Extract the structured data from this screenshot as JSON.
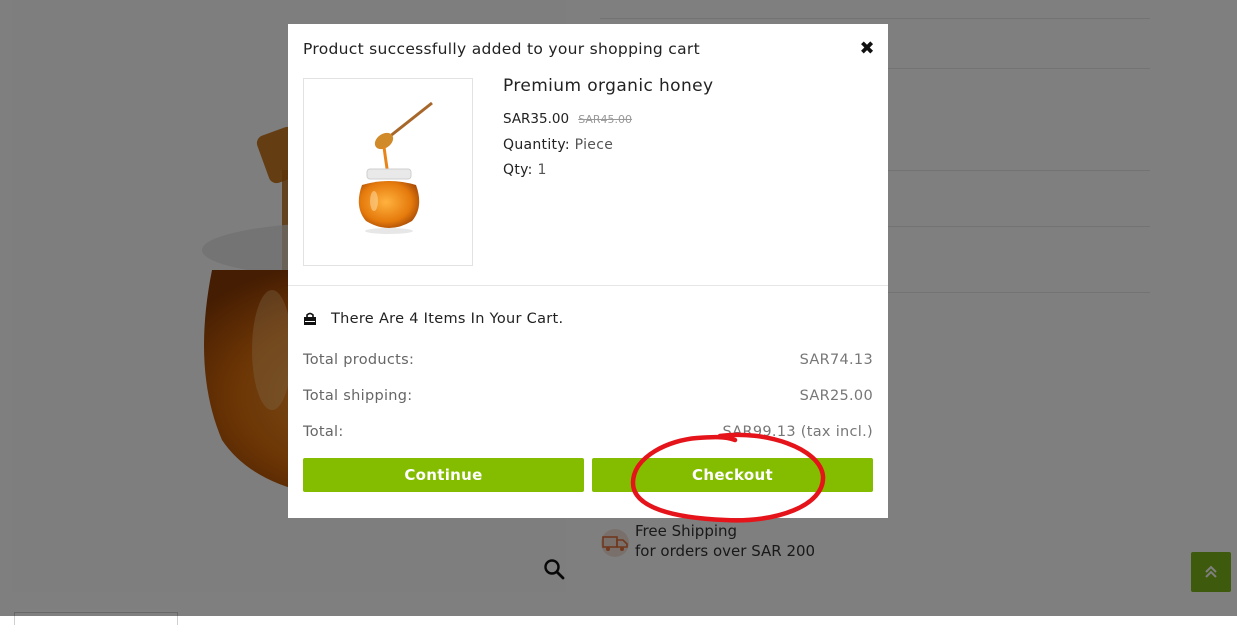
{
  "background": {
    "shipping": {
      "title": "Free Shipping",
      "subtitle": "for orders over SAR 200"
    }
  },
  "modal": {
    "title": "Product successfully added to your shopping cart",
    "close_icon": "close-icon",
    "product": {
      "name": "Premium organic honey",
      "price": "SAR35.00",
      "old_price": "SAR45.00",
      "quantity_label": "Quantity:",
      "quantity_value": "Piece",
      "qty_label": "Qty:",
      "qty_value": "1",
      "image_icon": "honey-jar-icon"
    },
    "cart": {
      "count_text": "There Are 4 Items In Your Cart.",
      "rows": [
        {
          "label": "Total products:",
          "value": "SAR74.13"
        },
        {
          "label": "Total shipping:",
          "value": "SAR25.00"
        },
        {
          "label": "Total:",
          "value": "SAR99.13 (tax incl.)"
        }
      ]
    },
    "buttons": {
      "continue": "Continue",
      "checkout": "Checkout"
    }
  },
  "colors": {
    "accent": "#84bd00",
    "overlay": "rgba(0,0,0,0.5)",
    "annotation": "#e5141b"
  }
}
